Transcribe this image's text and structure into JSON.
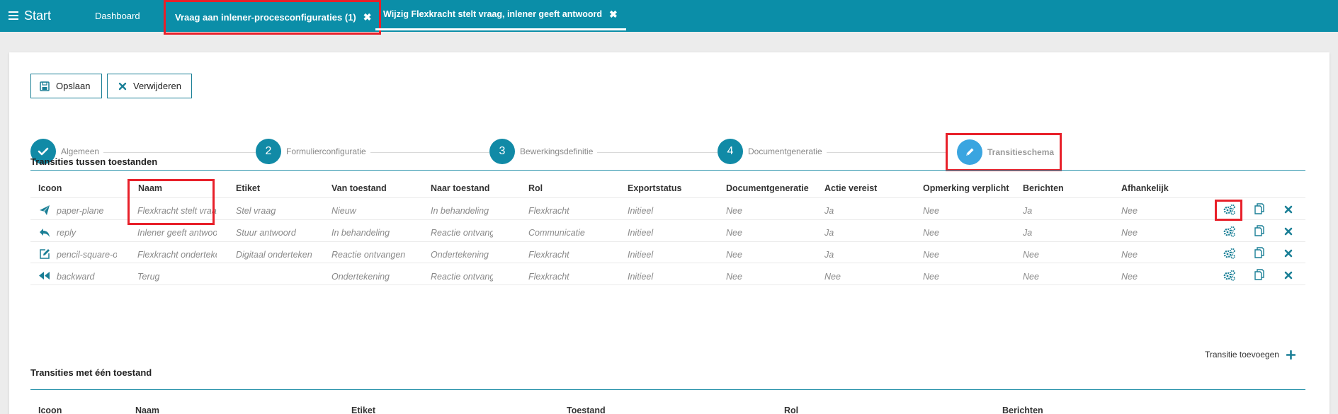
{
  "topbar": {
    "menu_label": "Start",
    "tabs": [
      {
        "label": "Dashboard"
      },
      {
        "label": "Vraag aan inlener-procesconfiguraties (1)"
      },
      {
        "label": "Wijzig Flexkracht stelt vraag, inlener geeft antwoord"
      }
    ]
  },
  "toolbar": {
    "save_label": "Opslaan",
    "delete_label": "Verwijderen"
  },
  "wizard": {
    "steps": [
      {
        "number": "",
        "label": "Algemeen",
        "state": "done"
      },
      {
        "number": "2",
        "label": "Formulierconfiguratie",
        "state": "todo"
      },
      {
        "number": "3",
        "label": "Bewerkingsdefinitie",
        "state": "todo"
      },
      {
        "number": "4",
        "label": "Documentgeneratie",
        "state": "todo"
      },
      {
        "number": "",
        "label": "Transitieschema",
        "state": "active"
      }
    ]
  },
  "transitions": {
    "title": "Transities tussen toestanden",
    "columns": [
      "Icoon",
      "Naam",
      "Etiket",
      "Van toestand",
      "Naar toestand",
      "Rol",
      "Exportstatus",
      "Documentgeneratie",
      "Actie vereist",
      "Opmerking verplicht",
      "Berichten",
      "Afhankelijk"
    ],
    "rows": [
      {
        "icon": "paper-plane",
        "naam": "Flexkracht stelt vraag",
        "etiket": "Stel vraag",
        "van": "Nieuw",
        "naar": "In behandeling",
        "rol": "Flexkracht",
        "export": "Initieel",
        "docgen": "Nee",
        "actie": "Ja",
        "opmerking": "Nee",
        "berichten": "Ja",
        "afhankelijk": "Nee"
      },
      {
        "icon": "reply",
        "naam": "Inlener geeft antwoord",
        "etiket": "Stuur antwoord",
        "van": "In behandeling",
        "naar": "Reactie ontvangen",
        "rol": "Communicatie",
        "export": "Initieel",
        "docgen": "Nee",
        "actie": "Ja",
        "opmerking": "Nee",
        "berichten": "Ja",
        "afhankelijk": "Nee"
      },
      {
        "icon": "pencil-square-o",
        "naam": "Flexkracht ondertekent",
        "etiket": "Digitaal onderteken",
        "van": "Reactie ontvangen",
        "naar": "Ondertekening",
        "rol": "Flexkracht",
        "export": "Initieel",
        "docgen": "Nee",
        "actie": "Ja",
        "opmerking": "Nee",
        "berichten": "Nee",
        "afhankelijk": "Nee"
      },
      {
        "icon": "backward",
        "naam": "Terug",
        "etiket": "",
        "van": "Ondertekening",
        "naar": "Reactie ontvangen",
        "rol": "Flexkracht",
        "export": "Initieel",
        "docgen": "Nee",
        "actie": "Nee",
        "opmerking": "Nee",
        "berichten": "Nee",
        "afhankelijk": "Nee"
      }
    ],
    "add_label": "Transitie toevoegen"
  },
  "single_state": {
    "title": "Transities met één toestand",
    "columns": [
      "Icoon",
      "Naam",
      "Etiket",
      "Toestand",
      "Rol",
      "Berichten"
    ]
  },
  "colors": {
    "topbar": "#0b8ea8",
    "accent": "#118aa6",
    "active_step": "#3aa5e0",
    "highlight": "#e8202a"
  }
}
